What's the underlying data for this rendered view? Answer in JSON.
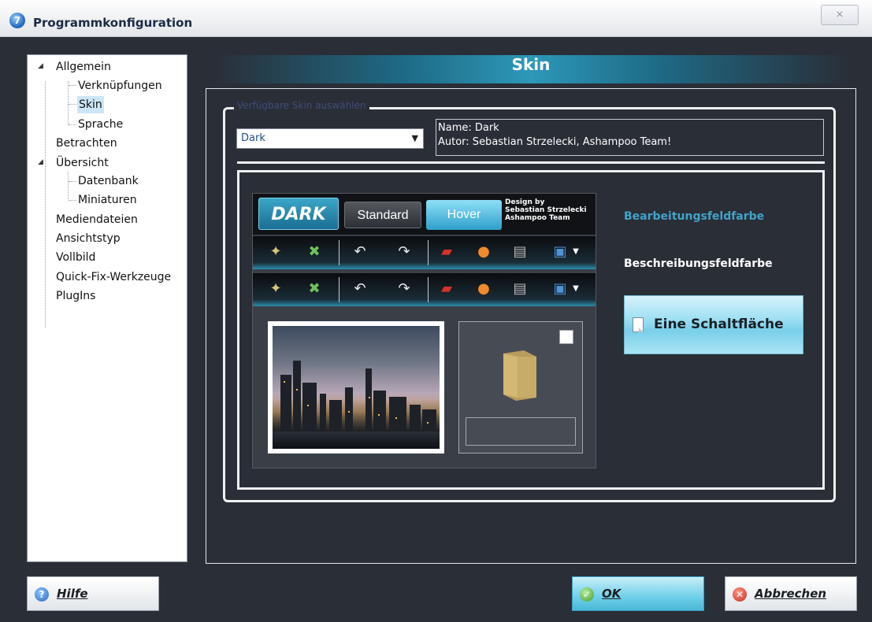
{
  "window": {
    "title": "Programmkonfiguration",
    "app_icon_glyph": "7",
    "close_glyph": "⨯"
  },
  "tree": {
    "items": [
      {
        "label": "Allgemein",
        "expandable": true,
        "expanded": true
      },
      {
        "label": "Verknüpfungen"
      },
      {
        "label": "Skin",
        "selected": true
      },
      {
        "label": "Sprache"
      },
      {
        "label": "Betrachten"
      },
      {
        "label": "Übersicht",
        "expandable": true,
        "expanded": true
      },
      {
        "label": "Datenbank"
      },
      {
        "label": "Miniaturen"
      },
      {
        "label": "Mediendateien"
      },
      {
        "label": "Ansichtstyp"
      },
      {
        "label": "Vollbild"
      },
      {
        "label": "Quick-Fix-Werkzeuge"
      },
      {
        "label": "PlugIns"
      }
    ]
  },
  "main": {
    "title": "Skin",
    "group_legend": "Verfügbare Skin auswählen",
    "skin_select": {
      "value": "Dark"
    },
    "info": {
      "name_line": "Name: Dark",
      "author_line": "Autor: Sebastian Strzelecki, Ashampoo Team!"
    },
    "preview": {
      "tabs": {
        "dark": "DARK",
        "standard": "Standard",
        "hover": "Hover"
      },
      "design_by": [
        "Design by",
        "Sebastian Strzelecki",
        "Ashampoo Team"
      ],
      "toolbar_icons": [
        "image-enhance-icon",
        "rotate-person-icon",
        "undo-icon",
        "redo-icon",
        "pdf-icon",
        "burn-disc-icon",
        "file-cabinet-icon",
        "media-dropdown-icon"
      ]
    },
    "edit_field_color_label": "Bearbeitungsfeldfarbe",
    "desc_field_color_label": "Beschreibungsfeldfarbe",
    "sample_button_label": "Eine Schaltfläche"
  },
  "buttons": {
    "help": "Hilfe",
    "ok": "OK",
    "cancel": "Abbrechen"
  },
  "colors": {
    "background": "#2a2e37",
    "accent": "#2d98b8",
    "edit_field_color": "#42a3c8",
    "desc_field_color": "#ffffff"
  }
}
